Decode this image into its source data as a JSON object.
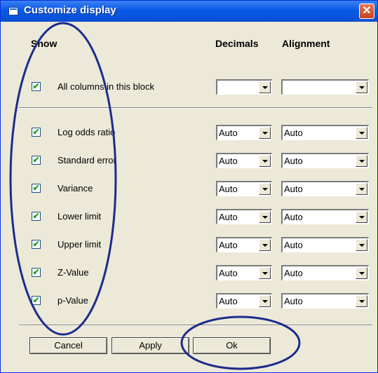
{
  "window": {
    "title": "Customize display"
  },
  "headers": {
    "show": "Show",
    "decimals": "Decimals",
    "alignment": "Alignment"
  },
  "all_columns": {
    "label": "All columns in this block",
    "checked": true,
    "decimals": "",
    "alignment": ""
  },
  "rows": [
    {
      "label": "Log odds ratio",
      "checked": true,
      "decimals": "Auto",
      "alignment": "Auto"
    },
    {
      "label": "Standard error",
      "checked": true,
      "decimals": "Auto",
      "alignment": "Auto"
    },
    {
      "label": "Variance",
      "checked": true,
      "decimals": "Auto",
      "alignment": "Auto"
    },
    {
      "label": "Lower limit",
      "checked": true,
      "decimals": "Auto",
      "alignment": "Auto"
    },
    {
      "label": "Upper limit",
      "checked": true,
      "decimals": "Auto",
      "alignment": "Auto"
    },
    {
      "label": "Z-Value",
      "checked": true,
      "decimals": "Auto",
      "alignment": "Auto"
    },
    {
      "label": "p-Value",
      "checked": true,
      "decimals": "Auto",
      "alignment": "Auto"
    }
  ],
  "buttons": {
    "cancel": "Cancel",
    "apply": "Apply",
    "ok": "Ok"
  },
  "checkmark": "✔",
  "close_glyph": "✕",
  "colors": {
    "title_bar": "#0a5ae6",
    "dialog_bg": "#ece9d8",
    "annotation": "#1c2c8c",
    "check": "#21a121"
  }
}
